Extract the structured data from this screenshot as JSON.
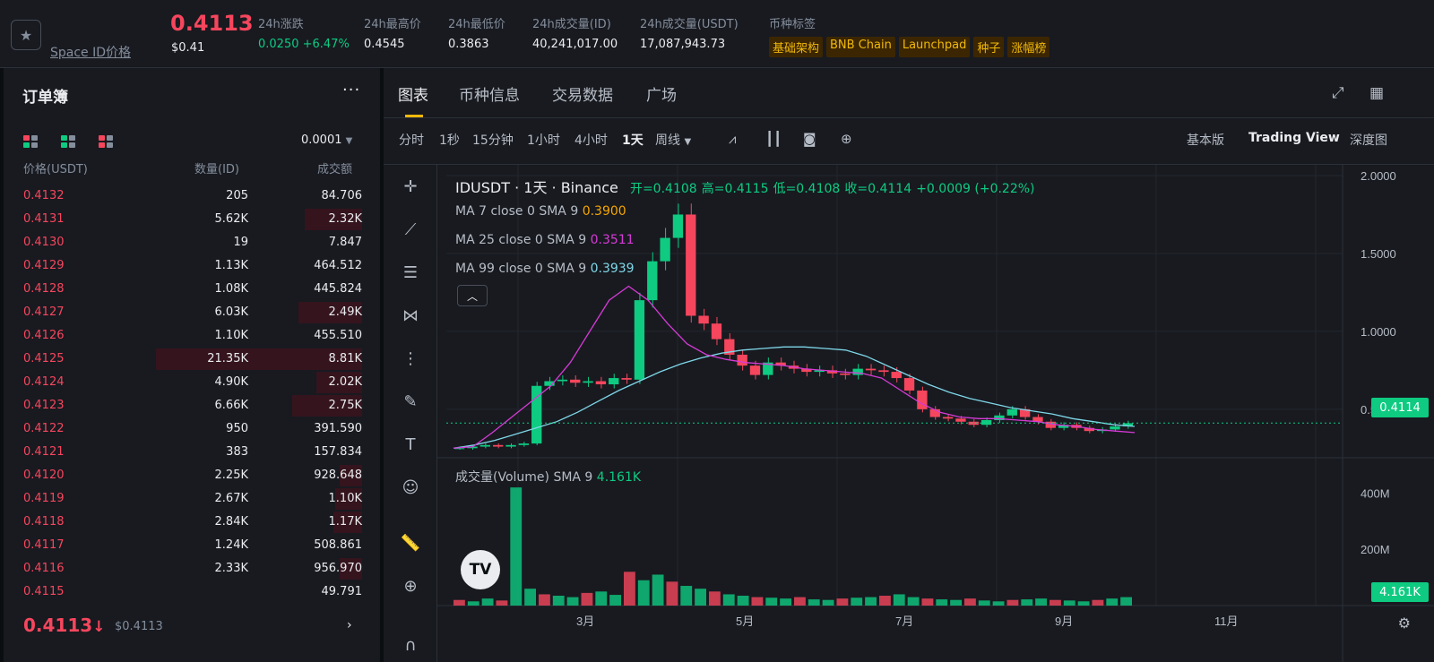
{
  "header": {
    "coin_name": "Space ID价格",
    "price": "0.4113",
    "price_usd": "$0.41",
    "stats": [
      {
        "label": "24h涨跌",
        "value": "0.0250 +6.47%",
        "positive": true
      },
      {
        "label": "24h最高价",
        "value": "0.4545"
      },
      {
        "label": "24h最低价",
        "value": "0.3863"
      },
      {
        "label": "24h成交量(ID)",
        "value": "40,241,017.00"
      },
      {
        "label": "24h成交量(USDT)",
        "value": "17,087,943.73"
      }
    ],
    "tags_label": "币种标签",
    "tags": [
      "基础架构",
      "BNB Chain",
      "Launchpad",
      "种子",
      "涨幅榜"
    ]
  },
  "orderbook": {
    "title": "订单簿",
    "more": "···",
    "precision": "0.0001",
    "col_price": "价格(USDT)",
    "col_qty": "数量(ID)",
    "col_total": "成交额",
    "rows": [
      {
        "price": "0.4132",
        "qty": "205",
        "total": "84.706",
        "depth": 0.0
      },
      {
        "price": "0.4131",
        "qty": "5.62K",
        "total": "2.32K",
        "depth": 0.28
      },
      {
        "price": "0.4130",
        "qty": "19",
        "total": "7.847",
        "depth": 0.0
      },
      {
        "price": "0.4129",
        "qty": "1.13K",
        "total": "464.512",
        "depth": 0.0
      },
      {
        "price": "0.4128",
        "qty": "1.08K",
        "total": "445.824",
        "depth": 0.0
      },
      {
        "price": "0.4127",
        "qty": "6.03K",
        "total": "2.49K",
        "depth": 0.31
      },
      {
        "price": "0.4126",
        "qty": "1.10K",
        "total": "455.510",
        "depth": 0.0
      },
      {
        "price": "0.4125",
        "qty": "21.35K",
        "total": "8.81K",
        "depth": 1.0
      },
      {
        "price": "0.4124",
        "qty": "4.90K",
        "total": "2.02K",
        "depth": 0.22
      },
      {
        "price": "0.4123",
        "qty": "6.66K",
        "total": "2.75K",
        "depth": 0.34
      },
      {
        "price": "0.4122",
        "qty": "950",
        "total": "391.590",
        "depth": 0.0
      },
      {
        "price": "0.4121",
        "qty": "383",
        "total": "157.834",
        "depth": 0.0
      },
      {
        "price": "0.4120",
        "qty": "2.25K",
        "total": "928.648",
        "depth": 0.11
      },
      {
        "price": "0.4119",
        "qty": "2.67K",
        "total": "1.10K",
        "depth": 0.13
      },
      {
        "price": "0.4118",
        "qty": "2.84K",
        "total": "1.17K",
        "depth": 0.14
      },
      {
        "price": "0.4117",
        "qty": "1.24K",
        "total": "508.861",
        "depth": 0.0
      },
      {
        "price": "0.4116",
        "qty": "2.33K",
        "total": "956.970",
        "depth": 0.11
      },
      {
        "price": "0.4115",
        "qty": "",
        "total": "49.791",
        "depth": 0.0
      }
    ],
    "last_price": "0.4113",
    "last_arrow": "↓",
    "last_usd": "$0.4113"
  },
  "chart_panel": {
    "tabs": [
      "图表",
      "币种信息",
      "交易数据",
      "广场"
    ],
    "timeframes": [
      "分时",
      "1秒",
      "15分钟",
      "1小时",
      "4小时",
      "1天",
      "周线"
    ],
    "selected_timeframe": "1天",
    "views": [
      "基本版",
      "Trading View",
      "深度图"
    ],
    "selected_view": "Trading View"
  },
  "chart_data": {
    "type": "candlestick",
    "symbol": "IDUSDT · 1天 · Binance",
    "ohlc": {
      "open_label": "开=0.4108",
      "high_label": "高=0.4115",
      "low_label": "低=0.4108",
      "close_label": "收=0.4114",
      "change_label": "+0.0009 (+0.22%)"
    },
    "indicators": [
      {
        "label": "MA 7 close 0 SMA 9",
        "value": "0.3900",
        "color": "#f7a600"
      },
      {
        "label": "MA 25 close 0 SMA 9",
        "value": "0.3511",
        "color": "#d63ad6"
      },
      {
        "label": "MA 99 close 0 SMA 9",
        "value": "0.3939",
        "color": "#7fd7e8"
      }
    ],
    "volume_label": "成交量(Volume) SMA 9",
    "volume_value": "4.161K",
    "current_price_tag": "0.4114",
    "volume_tag": "4.161K",
    "price_axis": [
      "2.0000",
      "1.5000",
      "1.0000",
      "0.5000"
    ],
    "price_axis_values": [
      2.0,
      1.5,
      1.0,
      0.5
    ],
    "volume_axis": [
      "400M",
      "200M"
    ],
    "volume_axis_values": [
      400,
      200
    ],
    "time_axis": [
      "3月",
      "5月",
      "7月",
      "9月",
      "11月"
    ],
    "ylim": [
      0.2,
      2.0
    ],
    "close_series": [
      0.25,
      0.26,
      0.27,
      0.26,
      0.27,
      0.28,
      0.65,
      0.68,
      0.69,
      0.67,
      0.68,
      0.66,
      0.7,
      0.69,
      1.2,
      1.45,
      1.6,
      1.75,
      1.1,
      1.05,
      0.95,
      0.85,
      0.78,
      0.72,
      0.8,
      0.78,
      0.76,
      0.74,
      0.75,
      0.73,
      0.72,
      0.76,
      0.75,
      0.74,
      0.7,
      0.62,
      0.5,
      0.45,
      0.44,
      0.42,
      0.4,
      0.43,
      0.46,
      0.5,
      0.45,
      0.42,
      0.38,
      0.4,
      0.38,
      0.36,
      0.37,
      0.39,
      0.41
    ],
    "ma99_series": [
      0.25,
      0.27,
      0.3,
      0.34,
      0.38,
      0.42,
      0.48,
      0.55,
      0.62,
      0.68,
      0.74,
      0.79,
      0.83,
      0.86,
      0.88,
      0.89,
      0.9,
      0.9,
      0.89,
      0.88,
      0.84,
      0.78,
      0.72,
      0.66,
      0.61,
      0.57,
      0.54,
      0.51,
      0.49,
      0.47,
      0.44,
      0.42,
      0.4,
      0.39
    ],
    "ma25_series": [
      0.25,
      0.26,
      0.35,
      0.45,
      0.55,
      0.65,
      0.8,
      1.0,
      1.2,
      1.29,
      1.2,
      1.05,
      0.92,
      0.85,
      0.82,
      0.8,
      0.79,
      0.78,
      0.76,
      0.75,
      0.74,
      0.73,
      0.7,
      0.62,
      0.54,
      0.48,
      0.45,
      0.44,
      0.44,
      0.43,
      0.42,
      0.4,
      0.39,
      0.37,
      0.36,
      0.35
    ],
    "volume_series": [
      20,
      15,
      25,
      18,
      420,
      60,
      40,
      35,
      30,
      45,
      50,
      38,
      120,
      90,
      110,
      85,
      70,
      60,
      50,
      40,
      35,
      30,
      28,
      25,
      30,
      22,
      20,
      25,
      28,
      30,
      35,
      40,
      30,
      25,
      22,
      20,
      25,
      18,
      15,
      20,
      22,
      25,
      20,
      18,
      15,
      20,
      25,
      30
    ]
  }
}
